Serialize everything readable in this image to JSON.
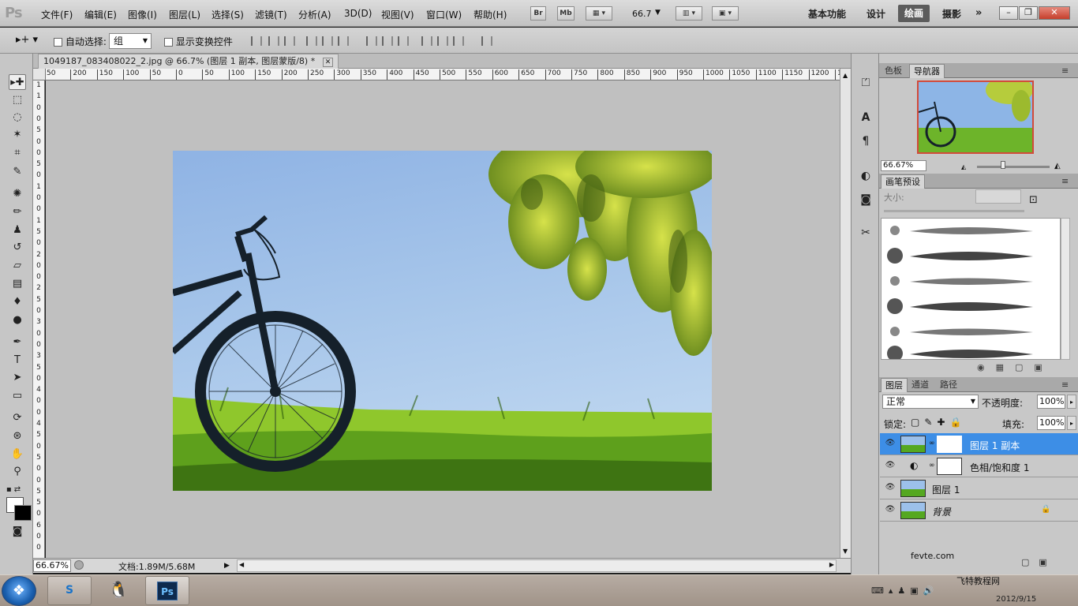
{
  "app": {
    "logo": "Ps"
  },
  "menu": [
    "文件(F)",
    "编辑(E)",
    "图像(I)",
    "图层(L)",
    "选择(S)",
    "滤镜(T)",
    "分析(A)",
    "3D(D)",
    "视图(V)",
    "窗口(W)",
    "帮助(H)"
  ],
  "appbar": {
    "br": "Br",
    "mb": "Mb",
    "zoom": "66.7"
  },
  "workspaces": [
    "基本功能",
    "设计",
    "绘画",
    "摄影"
  ],
  "active_workspace": "绘画",
  "window_controls": {
    "minimize": "–",
    "restore": "❐",
    "close": "✕"
  },
  "options": {
    "auto_select_label": "自动选择:",
    "auto_select_value": "组",
    "show_transform_label": "显示变换控件"
  },
  "document": {
    "tab_title": "1049187_083408022_2.jpg @ 66.7% (图层 1 副本, 图层蒙版/8) *",
    "tab_close": "✕",
    "zoom": "66.67%",
    "doc_size": "文档:1.89M/5.68M",
    "ruler_top": [
      "50",
      "200",
      "150",
      "100",
      "50",
      "0",
      "50",
      "100",
      "150",
      "200",
      "250",
      "300",
      "350",
      "400",
      "450",
      "500",
      "550",
      "600",
      "650",
      "700",
      "750",
      "800",
      "850",
      "900",
      "950",
      "1000",
      "1050",
      "1100",
      "1150",
      "1200",
      "12"
    ],
    "ruler_left": [
      "1",
      "1",
      "0",
      "0",
      "5",
      "0",
      "0",
      "5",
      "0",
      "1",
      "0",
      "0",
      "1",
      "5",
      "0",
      "2",
      "0",
      "0",
      "2",
      "5",
      "0",
      "3",
      "0",
      "0",
      "3",
      "5",
      "0",
      "4",
      "0",
      "0",
      "4",
      "5",
      "0",
      "5",
      "0",
      "0",
      "5",
      "5",
      "0",
      "6",
      "0",
      "0"
    ]
  },
  "navigator": {
    "tabs": [
      "色板",
      "导航器"
    ],
    "active": "导航器",
    "zoom": "66.67%"
  },
  "brush_presets": {
    "tab": "画笔预设",
    "size_label": "大小:"
  },
  "layers_panel": {
    "tabs": [
      "图层",
      "通道",
      "路径"
    ],
    "active": "图层",
    "blend_mode": "正常",
    "opacity_label": "不透明度:",
    "opacity": "100%",
    "lock_label": "锁定:",
    "fill_label": "填充:",
    "fill": "100%",
    "layers": [
      {
        "name": "图层 1 副本",
        "selected": true,
        "has_mask": true
      },
      {
        "name": "色相/饱和度 1",
        "selected": false,
        "adjustment": true
      },
      {
        "name": "图层 1",
        "selected": false
      },
      {
        "name": "背景",
        "selected": false,
        "locked": true
      }
    ]
  },
  "watermark": {
    "site": "fevte.com",
    "cn": "飞特教程网",
    "date": "2012/9/15"
  },
  "taskbar": {
    "ps_label": "Ps"
  }
}
